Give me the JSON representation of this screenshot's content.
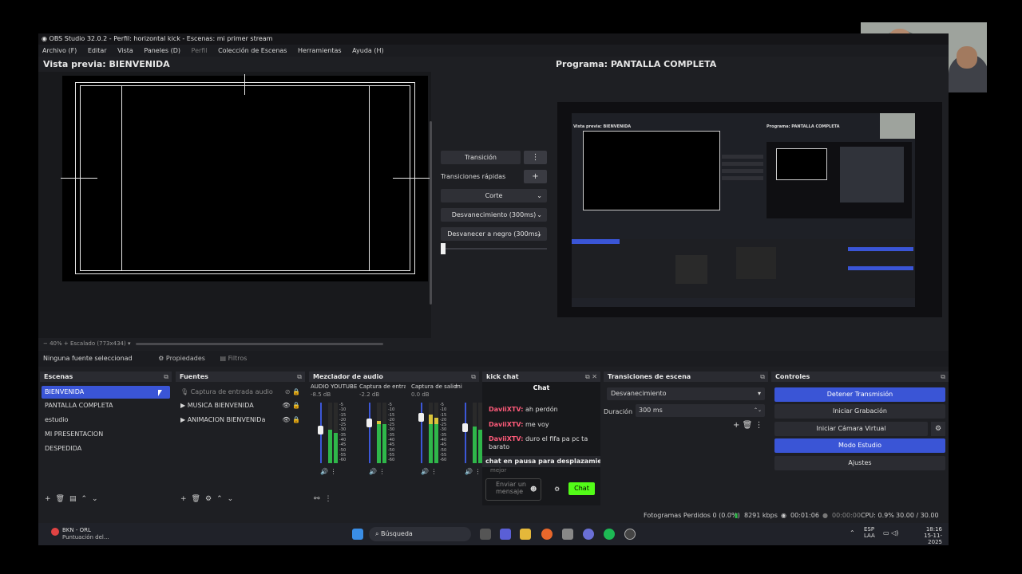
{
  "window": {
    "title": "OBS Studio 32.0.2 - Perfil: horizontal kick - Escenas: mi primer stream",
    "menu": [
      "Archivo (F)",
      "Editar",
      "Vista",
      "Paneles (D)",
      "Perfil",
      "Colección de Escenas",
      "Herramientas",
      "Ayuda (H)"
    ]
  },
  "preview": {
    "label": "Vista previa: BIENVENIDA",
    "zoom": "40%",
    "scale": "Escalado (773x434)"
  },
  "program": {
    "label": "Programa: PANTALLA COMPLETA"
  },
  "transition_controls": {
    "transition_label": "Transición",
    "quick_label": "Transiciones rápidas",
    "add": "+",
    "menu": "⋮",
    "options": [
      "Corte",
      "Desvanecimiento (300ms)",
      "Desvanecer a negro (300ms)"
    ]
  },
  "source_bar": {
    "none_selected": "Ninguna fuente seleccionad",
    "properties": "Propiedades",
    "filters": "Filtros"
  },
  "scenes": {
    "title": "Escenas",
    "items": [
      "BIENVENIDA",
      "PANTALLA COMPLETA",
      "estudio",
      "MI PRESENTACION",
      "DESPEDIDA"
    ]
  },
  "sources": {
    "title": "Fuentes",
    "items": [
      "Captura de entrada audio",
      "MUSICA BIENVENIDA",
      "ANIMACION BIENVENIDa"
    ]
  },
  "mixer": {
    "title": "Mezclador de audio",
    "channels": [
      {
        "name": "AUDIO YOUTUBE",
        "db": "-8.5 dB",
        "level": 0.55
      },
      {
        "name": "Captura de entrada",
        "db": "-2.2 dB",
        "level": 0.7
      },
      {
        "name": "Captura de salida c",
        "db": "0.0 dB",
        "level": 0.8
      },
      {
        "name": "mi",
        "db": "",
        "level": 0.6
      }
    ],
    "scale": [
      "-5",
      "-10",
      "-15",
      "-20",
      "-25",
      "-30",
      "-35",
      "-40",
      "-45",
      "-50",
      "-55",
      "-60"
    ]
  },
  "chat": {
    "title": "kick chat",
    "header": "Chat",
    "messages": [
      {
        "user": "DaviiXTV:",
        "text": "ah perdón"
      },
      {
        "user": "DaviiXTV:",
        "text": "me voy"
      },
      {
        "user": "DaviiXTV:",
        "text": "duro el fifa pa pc ta barato"
      }
    ],
    "paused": "chat en pausa para desplazamiento",
    "paused2": "mejor",
    "input_placeholder": "Enviar un mensaje",
    "send": "Chat",
    "accent": "#53fc18"
  },
  "scene_transitions": {
    "title": "Transiciones de escena",
    "selected": "Desvanecimiento",
    "duration_label": "Duración",
    "duration_value": "300 ms"
  },
  "controls": {
    "title": "Controles",
    "buttons": [
      "Detener Transmisión",
      "Iniciar Grabación",
      "Iniciar Cámara Virtual",
      "Modo Estudio",
      "Ajustes"
    ],
    "accent": "#3a55d6"
  },
  "status": {
    "dropped": "Fotogramas Perdidos 0 (0.0%)",
    "bitrate": "8291 kbps",
    "stream_time": "00:01:06",
    "rec_time": "00:00:00",
    "cpu": "CPU: 0.9%",
    "fps": "30.00 / 30.00 FPS"
  },
  "taskbar": {
    "app_name": "BKN - ORL",
    "app_sub": "Puntuación del...",
    "search": "Búsqueda",
    "lang1": "ESP",
    "lang2": "LAA",
    "time": "18:16",
    "date": "15-11-2025"
  },
  "mini": {
    "title": "Vista previa: BIENVENIDA",
    "program": "Programa: PANTALLA COMPLETA"
  }
}
